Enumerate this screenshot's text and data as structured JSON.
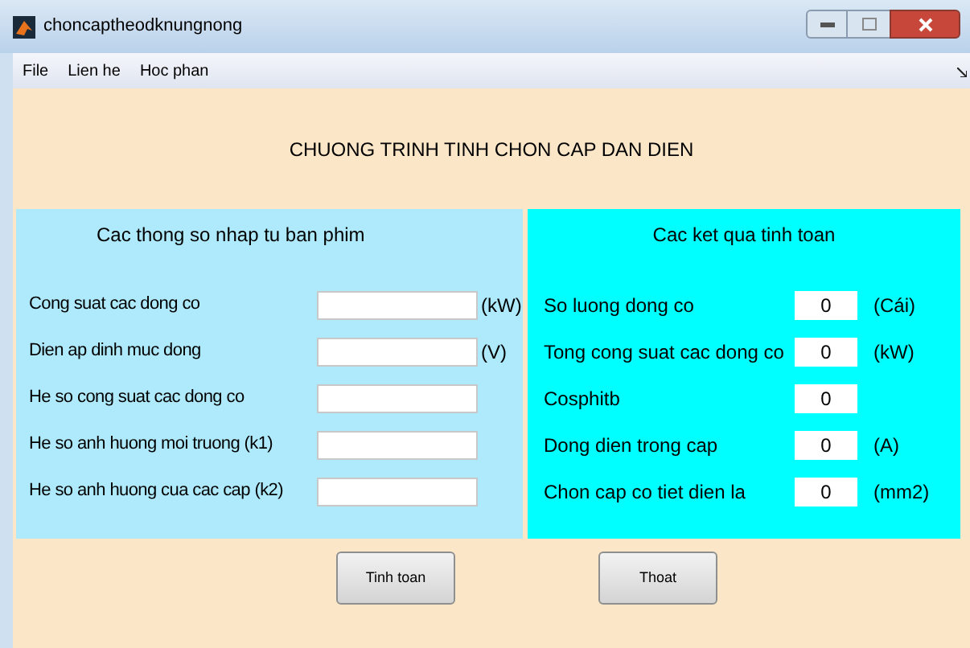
{
  "window": {
    "title": "choncaptheodknungnong"
  },
  "menu": [
    "File",
    "Lien he",
    "Hoc phan"
  ],
  "heading": "CHUONG TRINH TINH CHON CAP DAN DIEN",
  "input_panel": {
    "title": "Cac thong so nhap tu ban  phim",
    "fields": [
      {
        "label": "Cong suat cac dong co",
        "unit": "(kW)"
      },
      {
        "label": "Dien ap dinh muc dong",
        "unit": "(V)"
      },
      {
        "label": "He so cong suat cac dong co"
      },
      {
        "label": "He so anh huong moi truong (k1)"
      },
      {
        "label": "He so anh huong cua cac cap (k2)"
      }
    ]
  },
  "result_panel": {
    "title": "Cac ket qua tinh toan",
    "fields": [
      {
        "label": "So luong dong co",
        "value": "0",
        "unit": "(Cái)"
      },
      {
        "label": "Tong cong suat cac dong co",
        "value": "0",
        "unit": "(kW)"
      },
      {
        "label": "Cosphitb",
        "value": "0"
      },
      {
        "label": "Dong dien trong cap",
        "value": "0",
        "unit": "(A)"
      },
      {
        "label": "Chon cap co tiet dien la",
        "value": "0",
        "unit": "(mm2)"
      }
    ]
  },
  "buttons": [
    "Tinh toan",
    "Thoat"
  ]
}
